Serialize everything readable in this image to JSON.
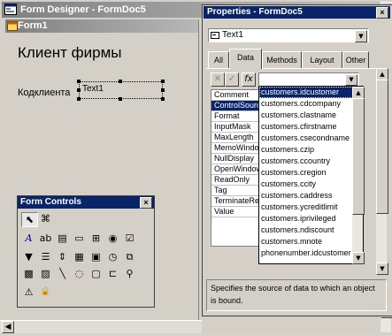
{
  "app": {
    "title": "Form Designer - FormDoc5",
    "colors": {
      "titlebar_active": "#0a246a",
      "titlebar_inactive": "#808080",
      "face": "#d4d0c8"
    }
  },
  "form": {
    "tab_title": "Form1",
    "heading": "Клиент фирмы",
    "code_label": "Кодклиента",
    "textbox_value": "Text1"
  },
  "form_controls": {
    "title": "Form Controls",
    "close": "×",
    "tools": [
      {
        "name": "pointer-tool-icon",
        "glyph": "⬉"
      },
      {
        "name": "builder-lock-icon",
        "glyph": "⌘"
      },
      {
        "name": "label-tool-icon",
        "glyph": "A"
      },
      {
        "name": "textbox-tool-icon",
        "glyph": "ab"
      },
      {
        "name": "editbox-tool-icon",
        "glyph": "▤"
      },
      {
        "name": "command-button-tool-icon",
        "glyph": "▭"
      },
      {
        "name": "button-group-tool-icon",
        "glyph": "⊞"
      },
      {
        "name": "option-group-tool-icon",
        "glyph": "◉"
      },
      {
        "name": "checkbox-tool-icon",
        "glyph": "☑"
      },
      {
        "name": "combobox-tool-icon",
        "glyph": "▼"
      },
      {
        "name": "listbox-tool-icon",
        "glyph": "☰"
      },
      {
        "name": "spinner-tool-icon",
        "glyph": "⇕"
      },
      {
        "name": "grid-tool-icon",
        "glyph": "▦"
      },
      {
        "name": "image-tool-icon",
        "glyph": "▣"
      },
      {
        "name": "timer-tool-icon",
        "glyph": "◷"
      },
      {
        "name": "pageframe-tool-icon",
        "glyph": "⧉"
      },
      {
        "name": "oleclass-tool-icon",
        "glyph": "▩"
      },
      {
        "name": "olebound-tool-icon",
        "glyph": "▨"
      },
      {
        "name": "line-tool-icon",
        "glyph": "╲"
      },
      {
        "name": "shape-tool-icon",
        "glyph": "◌"
      },
      {
        "name": "container-tool-icon",
        "glyph": "▢"
      },
      {
        "name": "separator-tool-icon",
        "glyph": "⊏"
      },
      {
        "name": "hyperlink-tool-icon",
        "glyph": "⚲"
      },
      {
        "name": "builder-tool-icon",
        "glyph": "⚠"
      },
      {
        "name": "lock-tool-icon",
        "glyph": "🔒"
      }
    ]
  },
  "properties": {
    "title": "Properties - FormDoc5",
    "close": "×",
    "object": "Text1",
    "tabs": [
      "All",
      "Data",
      "Methods",
      "Layout",
      "Other"
    ],
    "active_tab": "Data",
    "cancel_glyph": "✕",
    "accept_glyph": "✓",
    "fx_glyph": "fx",
    "prop_names": [
      "Comment",
      "ControlSource",
      "Format",
      "InputMask",
      "MaxLength",
      "MemoWindow",
      "NullDisplay",
      "OpenWindow",
      "ReadOnly",
      "Tag",
      "TerminateRead",
      "Value"
    ],
    "selected_prop": "ControlSource",
    "controlsource_options": [
      "customers.idcustomer",
      "customers.cdcompany",
      "customers.clastname",
      "customers.cfirstname",
      "customers.csecondname",
      "customers.czip",
      "customers.ccountry",
      "customers.cregion",
      "customers.ccity",
      "customers.caddress",
      "customers.ycreditlimit",
      "customers.iprivileged",
      "customers.ndiscount",
      "customers.mnote",
      "phonenumber.idcustomer"
    ],
    "selected_option": "customers.idcustomer",
    "description": "Specifies the source of data to which an object is bound."
  }
}
